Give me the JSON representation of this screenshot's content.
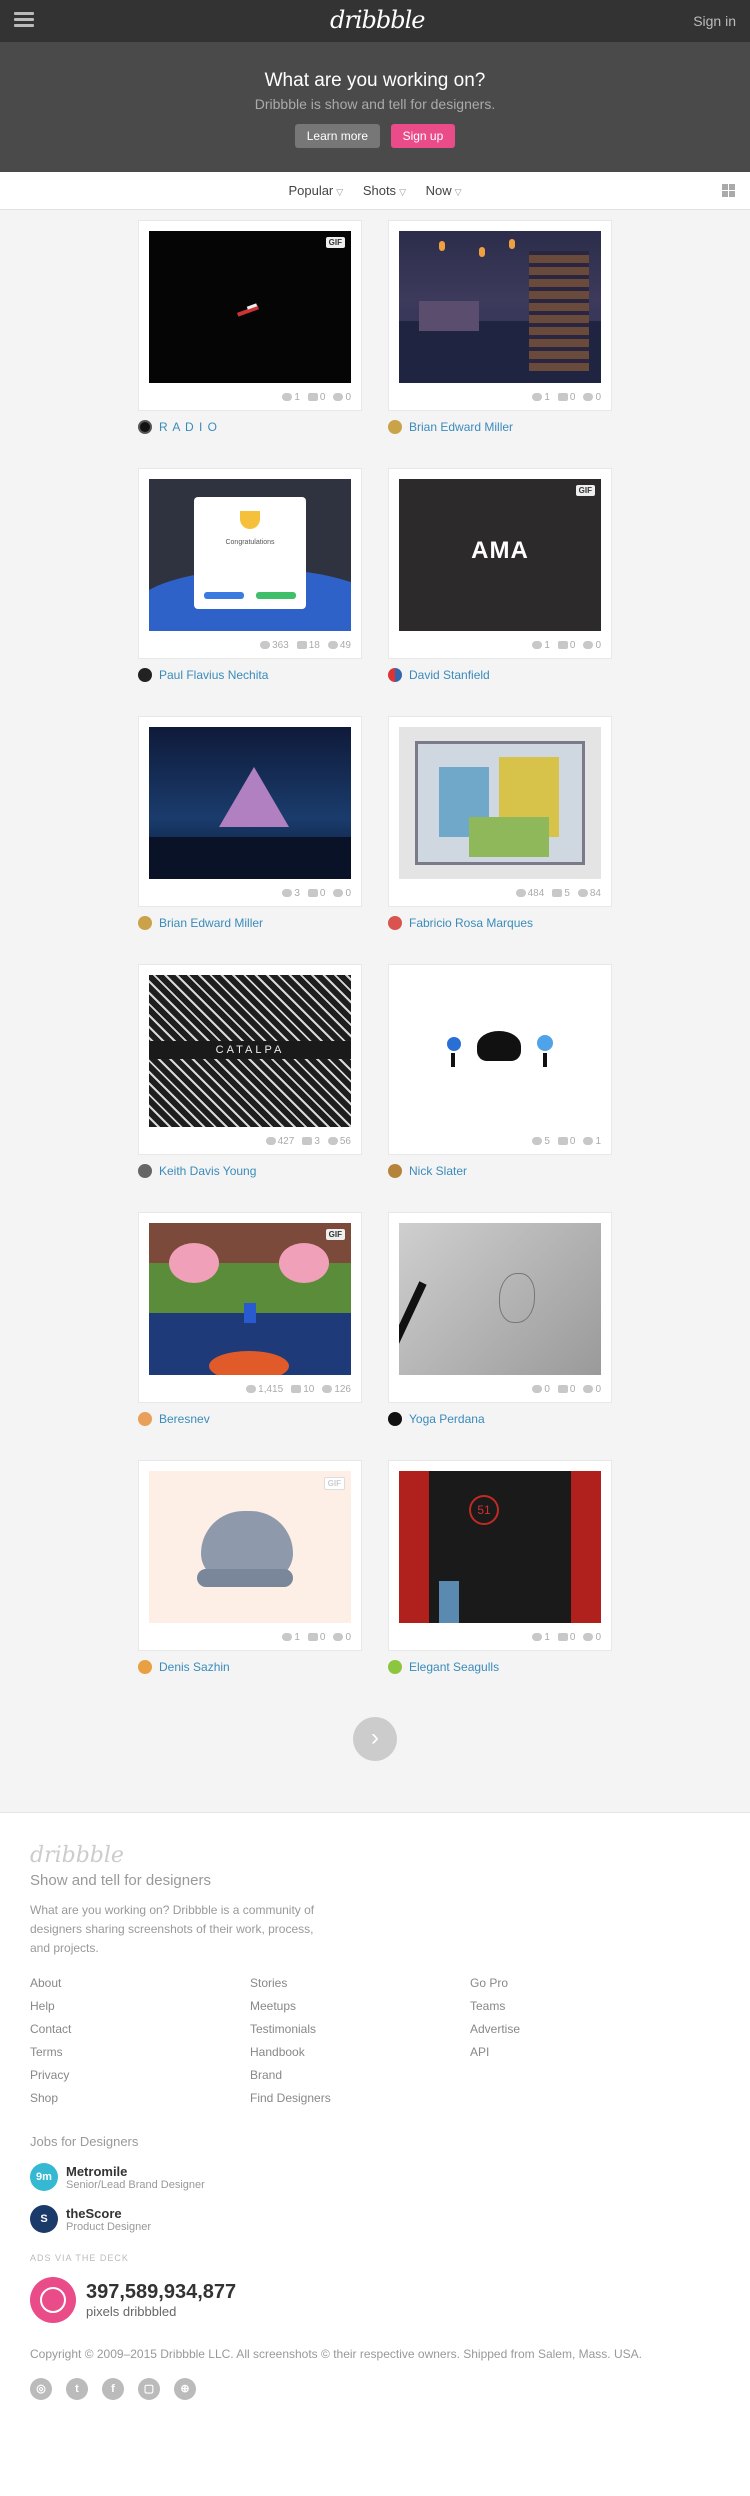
{
  "header": {
    "logo": "dribbble",
    "signin": "Sign in"
  },
  "hero": {
    "title": "What are you working on?",
    "subtitle": "Dribbble is show and tell for designers.",
    "learn_more": "Learn more",
    "sign_up": "Sign up"
  },
  "filters": {
    "popular": "Popular",
    "shots": "Shots",
    "now": "Now"
  },
  "shots": [
    {
      "author": "R A D I O",
      "views": "1",
      "comments": "0",
      "likes": "0",
      "gif": "GIF"
    },
    {
      "author": "Brian Edward Miller",
      "views": "1",
      "comments": "0",
      "likes": "0"
    },
    {
      "author": "Paul Flavius Nechita",
      "views": "363",
      "comments": "18",
      "likes": "49",
      "popup_title": "Congratulations"
    },
    {
      "author": "David Stanfield",
      "views": "1",
      "comments": "0",
      "likes": "0",
      "gif": "GIF",
      "art_text": "AMA"
    },
    {
      "author": "Brian Edward Miller",
      "views": "3",
      "comments": "0",
      "likes": "0"
    },
    {
      "author": "Fabricio Rosa Marques",
      "views": "484",
      "comments": "5",
      "likes": "84"
    },
    {
      "author": "Keith Davis Young",
      "views": "427",
      "comments": "3",
      "likes": "56",
      "art_text": "CATALPA"
    },
    {
      "author": "Nick Slater",
      "views": "5",
      "comments": "0",
      "likes": "1"
    },
    {
      "author": "Beresnev",
      "views": "1,415",
      "comments": "10",
      "likes": "126",
      "gif": "GIF"
    },
    {
      "author": "Yoga Perdana",
      "views": "0",
      "comments": "0",
      "likes": "0"
    },
    {
      "author": "Denis Sazhin",
      "views": "1",
      "comments": "0",
      "likes": "0",
      "gif": "GIF"
    },
    {
      "author": "Elegant Seagulls",
      "views": "1",
      "comments": "0",
      "likes": "0",
      "art_text": "51"
    }
  ],
  "footer": {
    "logo": "dribbble",
    "tagline": "Show and tell for designers",
    "description": "What are you working on? Dribbble is a community of designers sharing screenshots of their work, process, and projects.",
    "col1": [
      "About",
      "Help",
      "Contact",
      "Terms",
      "Privacy",
      "Shop"
    ],
    "col2": [
      "Stories",
      "Meetups",
      "Testimonials",
      "Handbook",
      "Brand",
      "Find Designers"
    ],
    "col3": [
      "Go Pro",
      "Teams",
      "Advertise",
      "API"
    ],
    "jobs_title": "Jobs for Designers",
    "jobs": [
      {
        "company": "Metromile",
        "role": "Senior/Lead Brand Designer"
      },
      {
        "company": "theScore",
        "role": "Product Designer"
      }
    ],
    "ads": "ADS VIA THE DECK",
    "pixels_count": "397,589,934,877",
    "pixels_label": "pixels dribbbled",
    "copyright": "Copyright © 2009–2015 Dribbble LLC. All screenshots © their respective owners. Shipped from Salem, Mass. USA."
  }
}
